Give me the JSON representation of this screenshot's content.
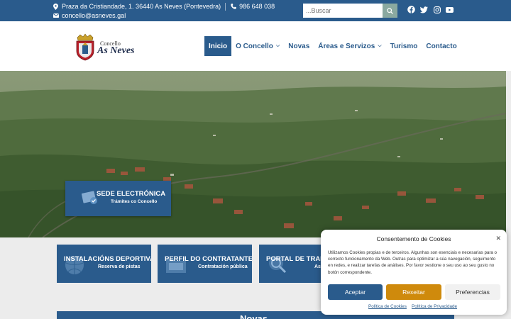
{
  "topbar": {
    "address": "Praza da Cristiandade, 1. 36440 As Neves (Pontevedra)",
    "phone": "986 648 038",
    "email": "concello@asneves.gal",
    "search_placeholder": "...Buscar",
    "social": [
      "facebook-icon",
      "twitter-icon",
      "instagram-icon",
      "youtube-icon"
    ]
  },
  "logo": {
    "small": "Concello",
    "big": "As Neves"
  },
  "nav": {
    "items": [
      {
        "label": "Inicio",
        "active": true
      },
      {
        "label": "O Concello",
        "dropdown": true
      },
      {
        "label": "Novas"
      },
      {
        "label": "Áreas e Servizos",
        "dropdown": true
      },
      {
        "label": "Turismo"
      },
      {
        "label": "Contacto"
      }
    ]
  },
  "hero": {
    "sede_title": "SEDE ELECTRÓNICA",
    "sede_sub": "Trámites co Concello"
  },
  "cards": [
    {
      "title": "INSTALACIÓNS DEPORTIVAS",
      "sub": "Reserva de pistas"
    },
    {
      "title": "PERFIL DO CONTRATANTE",
      "sub": "Contratación pública"
    },
    {
      "title": "PORTAL DE TRANSP",
      "sub": "As"
    }
  ],
  "novas_heading": "Novas",
  "cookie": {
    "title": "Consentemento de Cookies",
    "body": "Utilizamos Cookies propias e de terceiros. Algunhas son esenciais e necesarias para o correcto funcionamento da Web. Outras para optimizar a súa navegación, seguimento en redes, e realizar tarefas de análises. Por favor xestione o seu uso ao seu gusto no botón correspondente.",
    "accept": "Aceptar",
    "reject": "Rexeitar",
    "prefs": "Preferencias",
    "link_cookies": "Política de Cookies",
    "link_privacy": "Política de Privacidade"
  },
  "colors": {
    "primary": "#2a5b8c",
    "reject": "#cf8a0c",
    "search_btn": "#8aa9a0"
  }
}
